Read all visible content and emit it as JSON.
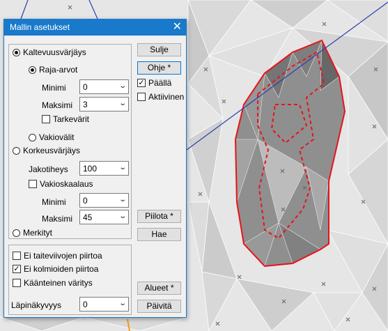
{
  "window": {
    "title": "Mallin asetukset",
    "close_icon": "close-icon"
  },
  "coloring": {
    "slope": {
      "label": "Kaltevuusvärjäys",
      "selected": true
    },
    "limits": {
      "label": "Raja-arvot",
      "selected": true
    },
    "slope_min": {
      "label": "Minimi",
      "value": "0"
    },
    "slope_max": {
      "label": "Maksimi",
      "value": "3"
    },
    "precise": {
      "label": "Tarkevärit",
      "checked": false
    },
    "constant_intervals": {
      "label": "Vakiovälit",
      "selected": false
    },
    "elevation": {
      "label": "Korkeusvärjäys",
      "selected": false
    },
    "interval": {
      "label": "Jakotiheys",
      "value": "100"
    },
    "constant_scale": {
      "label": "Vakioskaalaus",
      "checked": false
    },
    "elev_min": {
      "label": "Minimi",
      "value": "0"
    },
    "elev_max": {
      "label": "Maksimi",
      "value": "45"
    },
    "marked": {
      "label": "Merkityt",
      "selected": false
    }
  },
  "options": {
    "no_breaklines": {
      "label": "Ei taiteviivojen piirtoa",
      "checked": false
    },
    "no_triangles": {
      "label": "Ei kolmioiden piirtoa",
      "checked": true
    },
    "reverse": {
      "label": "Käänteinen väritys",
      "checked": false
    },
    "opacity": {
      "label": "Läpinäkyvyys",
      "value": "0"
    }
  },
  "buttons": {
    "close": "Sulje",
    "help": "Ohje *",
    "on": {
      "label": "Päällä",
      "checked": true
    },
    "active": {
      "label": "Aktiivinen",
      "checked": false
    },
    "hide": "Piilota *",
    "fetch": "Hae",
    "areas": "Alueet *",
    "update": "Päivitä"
  },
  "colors": {
    "titlebar": "#1979ca",
    "boundary": "#e8121a",
    "canvas": "#e4e4e4"
  }
}
